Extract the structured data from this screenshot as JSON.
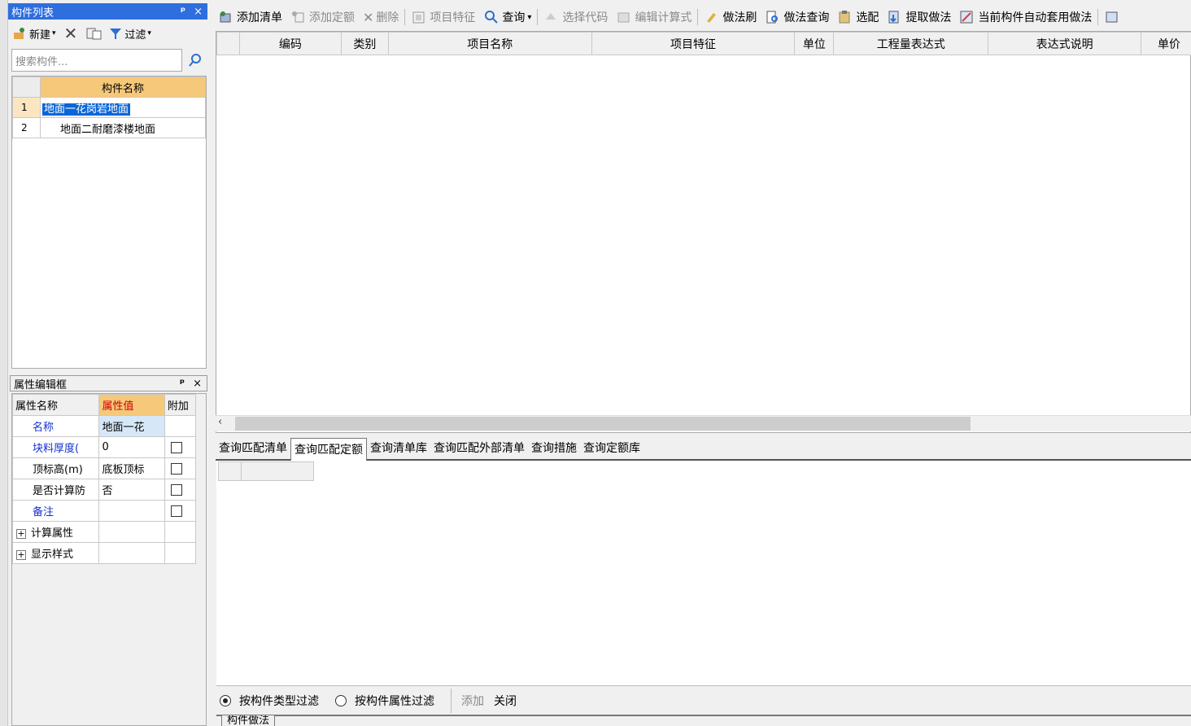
{
  "component_list": {
    "title": "构件列表",
    "pin": "ᵖ",
    "close": "×",
    "toolbar": {
      "new_label": "新建",
      "filter_label": "过滤"
    },
    "search_placeholder": "搜索构件...",
    "grid": {
      "header": "构件名称",
      "rows": [
        {
          "index": "1",
          "name": "地面一花岗岩地面"
        },
        {
          "index": "2",
          "name": "地面二耐磨漆楼地面"
        }
      ]
    }
  },
  "property_panel": {
    "title": "属性编辑框",
    "pin": "ᵖ",
    "close": "×",
    "headers": {
      "name": "属性名称",
      "value": "属性值",
      "extra": "附加"
    },
    "rows": [
      {
        "name": "名称",
        "value": "地面一花"
      },
      {
        "name": "块料厚度(",
        "value": "0"
      },
      {
        "name": "顶标高(m)",
        "value": "底板顶标"
      },
      {
        "name": "是否计算防",
        "value": "否"
      },
      {
        "name": "备注",
        "value": ""
      },
      {
        "name": "计算属性",
        "value": ""
      },
      {
        "name": "显示样式",
        "value": ""
      }
    ],
    "expand_symbol": "+"
  },
  "main_toolbar": {
    "add_list": "添加清单",
    "add_quota": "添加定额",
    "delete": "删除",
    "item_feature": "项目特征",
    "query": "查询",
    "select_code": "选择代码",
    "edit_formula": "编辑计算式",
    "method_brush": "做法刷",
    "method_query": "做法查询",
    "select_match": "选配",
    "extract_method": "提取做法",
    "auto_apply": "当前构件自动套用做法"
  },
  "main_grid": {
    "columns": [
      "编码",
      "类别",
      "项目名称",
      "项目特征",
      "单位",
      "工程量表达式",
      "表达式说明",
      "单价"
    ]
  },
  "query_tabs": {
    "tabs": [
      "查询匹配清单",
      "查询匹配定额",
      "查询清单库",
      "查询匹配外部清单",
      "查询措施",
      "查询定额库"
    ],
    "active_index": 1
  },
  "filter_bar": {
    "by_type": "按构件类型过滤",
    "by_property": "按构件属性过滤",
    "add": "添加",
    "close": "关闭"
  },
  "bottom_tab": {
    "label": "构件做法"
  },
  "colors": {
    "title_active": "#2f6ede",
    "header_orange": "#f6c87a",
    "selection": "#0a66d8",
    "link_blue": "#1530d0"
  }
}
